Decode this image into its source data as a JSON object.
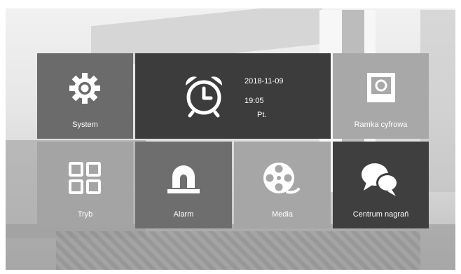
{
  "tiles": {
    "system": {
      "label": "System",
      "icon": "gear-icon"
    },
    "clock": {
      "date": "2018-11-09",
      "time": "19:05",
      "day": "Pt.",
      "icon": "alarm-clock-icon"
    },
    "frame": {
      "label": "Ramka cyfrowa",
      "icon": "picture-frame-icon"
    },
    "mode": {
      "label": "Tryb",
      "icon": "grid-icon"
    },
    "alarm": {
      "label": "Alarm",
      "icon": "siren-icon"
    },
    "media": {
      "label": "Media",
      "icon": "film-reel-icon"
    },
    "records": {
      "label": "Centrum nagrań",
      "icon": "chat-bubbles-icon"
    }
  },
  "colors": {
    "tile_dark": "#3c3c3c",
    "tile_mid": "#6b6b6b",
    "tile_light": "#a6a6a6",
    "text": "#ffffff"
  }
}
